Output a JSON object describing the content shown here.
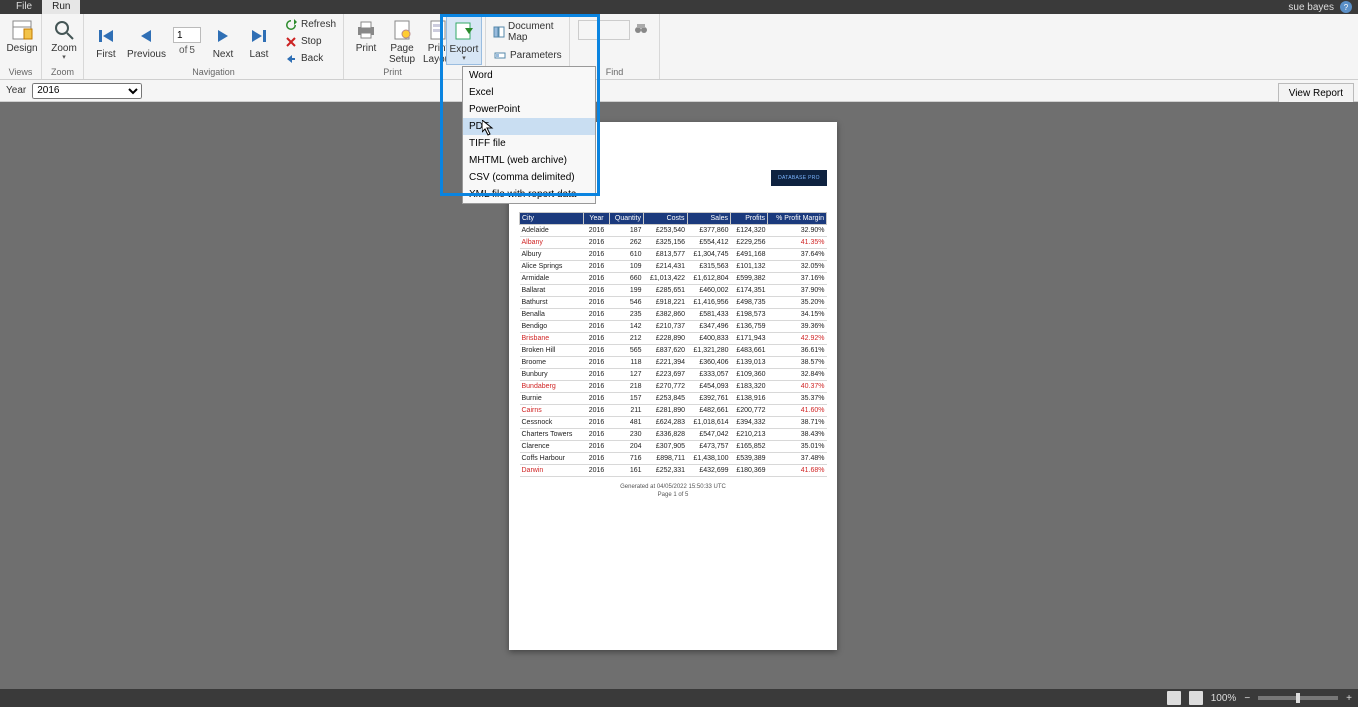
{
  "titlebar": {
    "tabs": [
      "File",
      "Run"
    ],
    "active_tab": "Run",
    "user": "sue bayes"
  },
  "ribbon": {
    "groups": {
      "views": {
        "label": "Views",
        "design": "Design"
      },
      "zoom": {
        "label": "Zoom",
        "zoom": "Zoom"
      },
      "navigation": {
        "label": "Navigation",
        "first": "First",
        "previous": "Previous",
        "next": "Next",
        "last": "Last",
        "page_value": "1",
        "of": "of",
        "total": "5",
        "refresh": "Refresh",
        "stop": "Stop",
        "back": "Back"
      },
      "print": {
        "label": "Print",
        "print": "Print",
        "page_setup": "Page\nSetup",
        "print_layout": "Print\nLayout"
      },
      "export": {
        "label": "Export"
      },
      "doc": {
        "docmap": "Document Map",
        "parameters": "Parameters"
      },
      "find": {
        "label": "Find"
      }
    }
  },
  "export_menu": {
    "items": [
      "Word",
      "Excel",
      "PowerPoint",
      "PDF",
      "TIFF file",
      "MHTML (web archive)",
      "CSV (comma delimited)",
      "XML file with report data"
    ],
    "hover_index": 3
  },
  "param": {
    "label": "Year",
    "value": "2016"
  },
  "view_report_btn": "View Report",
  "report": {
    "logo_text": "DATABASE PRO",
    "columns": [
      "City",
      "Year",
      "Quantity",
      "Costs",
      "Sales",
      "Profits",
      "% Profit Margin"
    ],
    "rows": [
      {
        "city": "Adelaide",
        "year": "2016",
        "qty": "187",
        "costs": "£253,540",
        "sales": "£377,860",
        "profits": "£124,320",
        "pm": "32.90%",
        "red": false
      },
      {
        "city": "Albany",
        "year": "2016",
        "qty": "262",
        "costs": "£325,156",
        "sales": "£554,412",
        "profits": "£229,256",
        "pm": "41.35%",
        "red": true
      },
      {
        "city": "Albury",
        "year": "2016",
        "qty": "610",
        "costs": "£813,577",
        "sales": "£1,304,745",
        "profits": "£491,168",
        "pm": "37.64%",
        "red": false
      },
      {
        "city": "Alice Springs",
        "year": "2016",
        "qty": "109",
        "costs": "£214,431",
        "sales": "£315,563",
        "profits": "£101,132",
        "pm": "32.05%",
        "red": false
      },
      {
        "city": "Armidale",
        "year": "2016",
        "qty": "660",
        "costs": "£1,013,422",
        "sales": "£1,612,804",
        "profits": "£599,382",
        "pm": "37.16%",
        "red": false
      },
      {
        "city": "Ballarat",
        "year": "2016",
        "qty": "199",
        "costs": "£285,651",
        "sales": "£460,002",
        "profits": "£174,351",
        "pm": "37.90%",
        "red": false
      },
      {
        "city": "Bathurst",
        "year": "2016",
        "qty": "546",
        "costs": "£918,221",
        "sales": "£1,416,956",
        "profits": "£498,735",
        "pm": "35.20%",
        "red": false
      },
      {
        "city": "Benalla",
        "year": "2016",
        "qty": "235",
        "costs": "£382,860",
        "sales": "£581,433",
        "profits": "£198,573",
        "pm": "34.15%",
        "red": false
      },
      {
        "city": "Bendigo",
        "year": "2016",
        "qty": "142",
        "costs": "£210,737",
        "sales": "£347,496",
        "profits": "£136,759",
        "pm": "39.36%",
        "red": false
      },
      {
        "city": "Brisbane",
        "year": "2016",
        "qty": "212",
        "costs": "£228,890",
        "sales": "£400,833",
        "profits": "£171,943",
        "pm": "42.92%",
        "red": true
      },
      {
        "city": "Broken Hill",
        "year": "2016",
        "qty": "565",
        "costs": "£837,620",
        "sales": "£1,321,280",
        "profits": "£483,661",
        "pm": "36.61%",
        "red": false
      },
      {
        "city": "Broome",
        "year": "2016",
        "qty": "118",
        "costs": "£221,394",
        "sales": "£360,406",
        "profits": "£139,013",
        "pm": "38.57%",
        "red": false
      },
      {
        "city": "Bunbury",
        "year": "2016",
        "qty": "127",
        "costs": "£223,697",
        "sales": "£333,057",
        "profits": "£109,360",
        "pm": "32.84%",
        "red": false
      },
      {
        "city": "Bundaberg",
        "year": "2016",
        "qty": "218",
        "costs": "£270,772",
        "sales": "£454,093",
        "profits": "£183,320",
        "pm": "40.37%",
        "red": true
      },
      {
        "city": "Burnie",
        "year": "2016",
        "qty": "157",
        "costs": "£253,845",
        "sales": "£392,761",
        "profits": "£138,916",
        "pm": "35.37%",
        "red": false
      },
      {
        "city": "Cairns",
        "year": "2016",
        "qty": "211",
        "costs": "£281,890",
        "sales": "£482,661",
        "profits": "£200,772",
        "pm": "41.60%",
        "red": true
      },
      {
        "city": "Cessnock",
        "year": "2016",
        "qty": "481",
        "costs": "£624,283",
        "sales": "£1,018,614",
        "profits": "£394,332",
        "pm": "38.71%",
        "red": false
      },
      {
        "city": "Charters Towers",
        "year": "2016",
        "qty": "230",
        "costs": "£336,828",
        "sales": "£547,042",
        "profits": "£210,213",
        "pm": "38.43%",
        "red": false
      },
      {
        "city": "Clarence",
        "year": "2016",
        "qty": "204",
        "costs": "£307,905",
        "sales": "£473,757",
        "profits": "£165,852",
        "pm": "35.01%",
        "red": false
      },
      {
        "city": "Coffs Harbour",
        "year": "2016",
        "qty": "716",
        "costs": "£898,711",
        "sales": "£1,438,100",
        "profits": "£539,389",
        "pm": "37.48%",
        "red": false
      },
      {
        "city": "Darwin",
        "year": "2016",
        "qty": "161",
        "costs": "£252,331",
        "sales": "£432,699",
        "profits": "£180,369",
        "pm": "41.68%",
        "red": true
      }
    ],
    "footer_generated": "Generated at 04/05/2022 15:50:33 UTC",
    "footer_page": "Page 1 of 5"
  },
  "statusbar": {
    "zoom": "100%"
  }
}
